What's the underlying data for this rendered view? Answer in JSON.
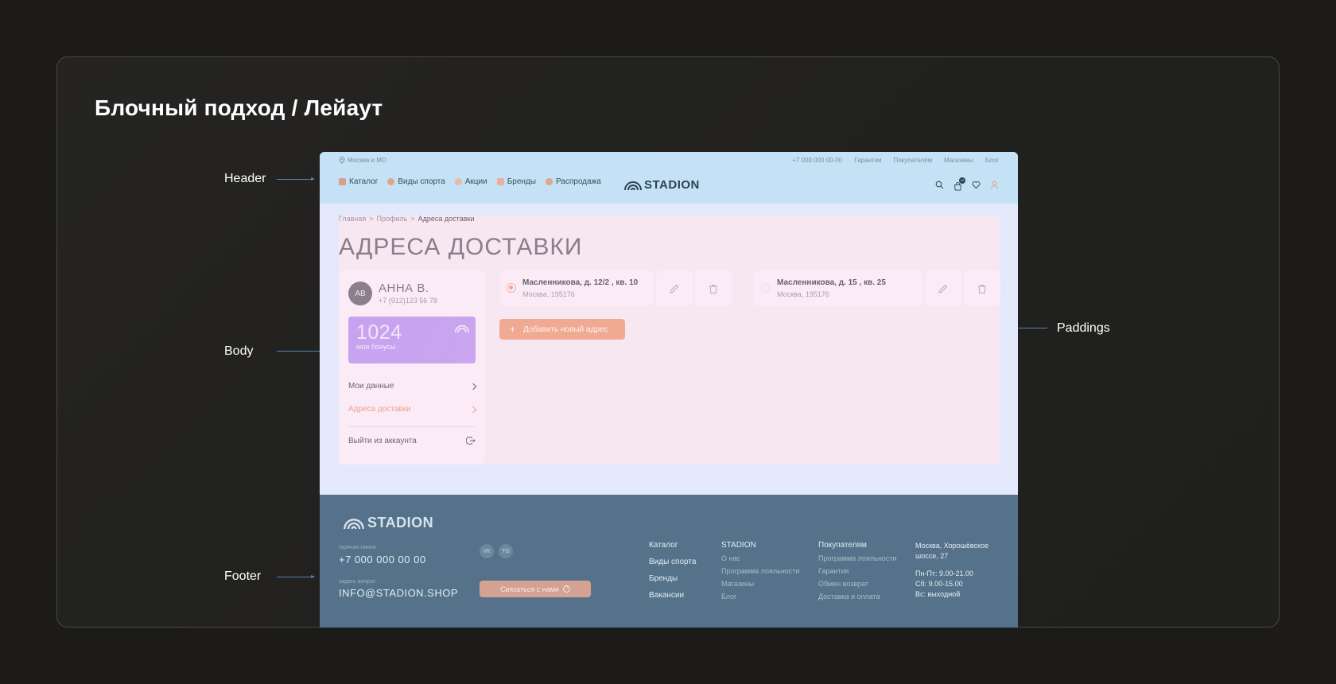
{
  "slide": {
    "title": "Блочный подход / Лейаут",
    "labels": {
      "header": "Header",
      "body": "Body",
      "footer": "Footer",
      "paddings": "Paddings"
    }
  },
  "site": {
    "topbar": {
      "location": "Москва и МО",
      "links": [
        "+7 000 000 00-00",
        "Гарантии",
        "Покупателям",
        "Магазины",
        "Блог"
      ]
    },
    "nav": [
      "Каталог",
      "Виды спорта",
      "Акции",
      "Бренды",
      "Распродажа"
    ],
    "logo": "STADION",
    "cart_count": "12",
    "breadcrumbs": {
      "home": "Главная",
      "profile": "Профиль",
      "current": "Адреса доставки"
    },
    "page_title": "АДРЕСА ДОСТАВКИ",
    "profile": {
      "initials": "АВ",
      "name": "АННА В.",
      "phone": "+7 (912)123 56 78",
      "bonus_amount": "1024",
      "bonus_label": "мои бонусы",
      "menu": {
        "my_data": "Мои данные",
        "addresses": "Адреса доставки",
        "logout": "Выйти из аккаунта"
      }
    },
    "addresses": [
      {
        "title": "Масленникова, д. 12/2 , кв. 10",
        "sub": "Москва, 195176",
        "selected": true
      },
      {
        "title": "Масленникова, д. 15 , кв. 25",
        "sub": "Москва, 195176",
        "selected": false
      }
    ],
    "add_address": "Добавить новый адрес",
    "footer": {
      "logo": "STADION",
      "hotline_label": "горячая линия",
      "hotline": "+7 000 000 00 00",
      "question_label": "задать вопрос",
      "email": "INFO@STADION.SHOP",
      "social": [
        "VK",
        "TG"
      ],
      "contact_button": "Связаться с нами",
      "main_links": [
        "Каталог",
        "Виды спорта",
        "Бренды",
        "Вакансии"
      ],
      "col_stadion": {
        "title": "STADION",
        "links": [
          "О нас",
          "Программа лояльности",
          "Магазины",
          "Блог"
        ]
      },
      "col_buyers": {
        "title": "Покупателям",
        "links": [
          "Программа лояльности",
          "Гарантия",
          "Обмен возврат",
          "Доставка и оплата"
        ]
      },
      "address_lines": [
        "Москва, Хорошёвское",
        "шоссе, 27"
      ],
      "hours": [
        "Пн-Пт: 9.00-21.00",
        "Сб: 9.00-15.00",
        "Вс: выходной"
      ]
    }
  },
  "colors": {
    "header_bg": "#c4e1f5",
    "body_bg": "#e4e8fb",
    "content_bg": "#f7e7f1",
    "footer_bg": "#55728a",
    "accent": "#f0aa92",
    "bonus_card": "#c7a2f0",
    "annotation_arrow": "#5e7fb0"
  }
}
